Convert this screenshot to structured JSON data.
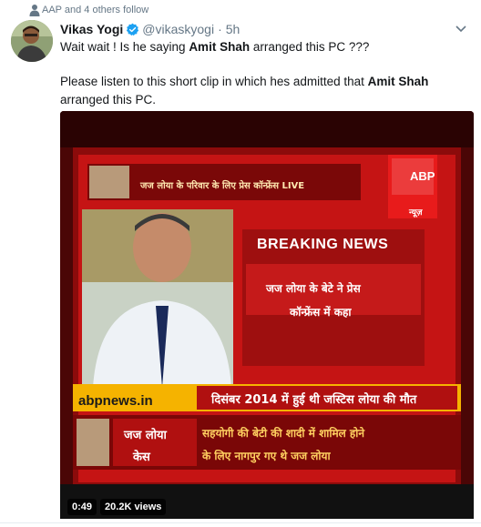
{
  "social_context": {
    "text": "AAP and 4 others follow",
    "icon": "person-icon"
  },
  "tweet": {
    "display_name": "Vikas Yogi",
    "verified": true,
    "handle": "@vikaskyogi",
    "separator": "·",
    "time": "5h",
    "paragraph1": {
      "before": "Wait wait ! Is he saying ",
      "bold": "Amit Shah",
      "after": " arranged this PC ???"
    },
    "paragraph2": {
      "before": "Please listen to this short clip in which hes admitted that ",
      "bold": "Amit Shah",
      "after": " arranged this PC."
    }
  },
  "video": {
    "duration": "0:49",
    "views": "20.2K views",
    "breaking": "BREAKING NEWS",
    "channel_url": "abpnews.in",
    "channel_logo": "ABP",
    "channel_logo_sub": "न्यूज़",
    "top_headline": "जज लोया के परिवार के लिए प्रेस कॉन्फ्रेंस LIVE",
    "headline_line1": "जज लोया के बेटे ने प्रेस",
    "headline_line2": "कॉन्फ्रेंस में कहा",
    "ticker": "दिसंबर 2014 में हुई थी जस्टिस लोया की मौत",
    "judge_label_line1": "जज लोया",
    "judge_label_line2": "केस",
    "sub_line1": "सहयोगी की बेटी की शादी में शामिल होने",
    "sub_line2": "के लिए नागपुर गए थे जज लोया"
  },
  "colors": {
    "verified_blue": "#1da1f2",
    "secondary_text": "#657786",
    "video_red": "#b51414",
    "ticker_yellow": "#f5b300"
  }
}
